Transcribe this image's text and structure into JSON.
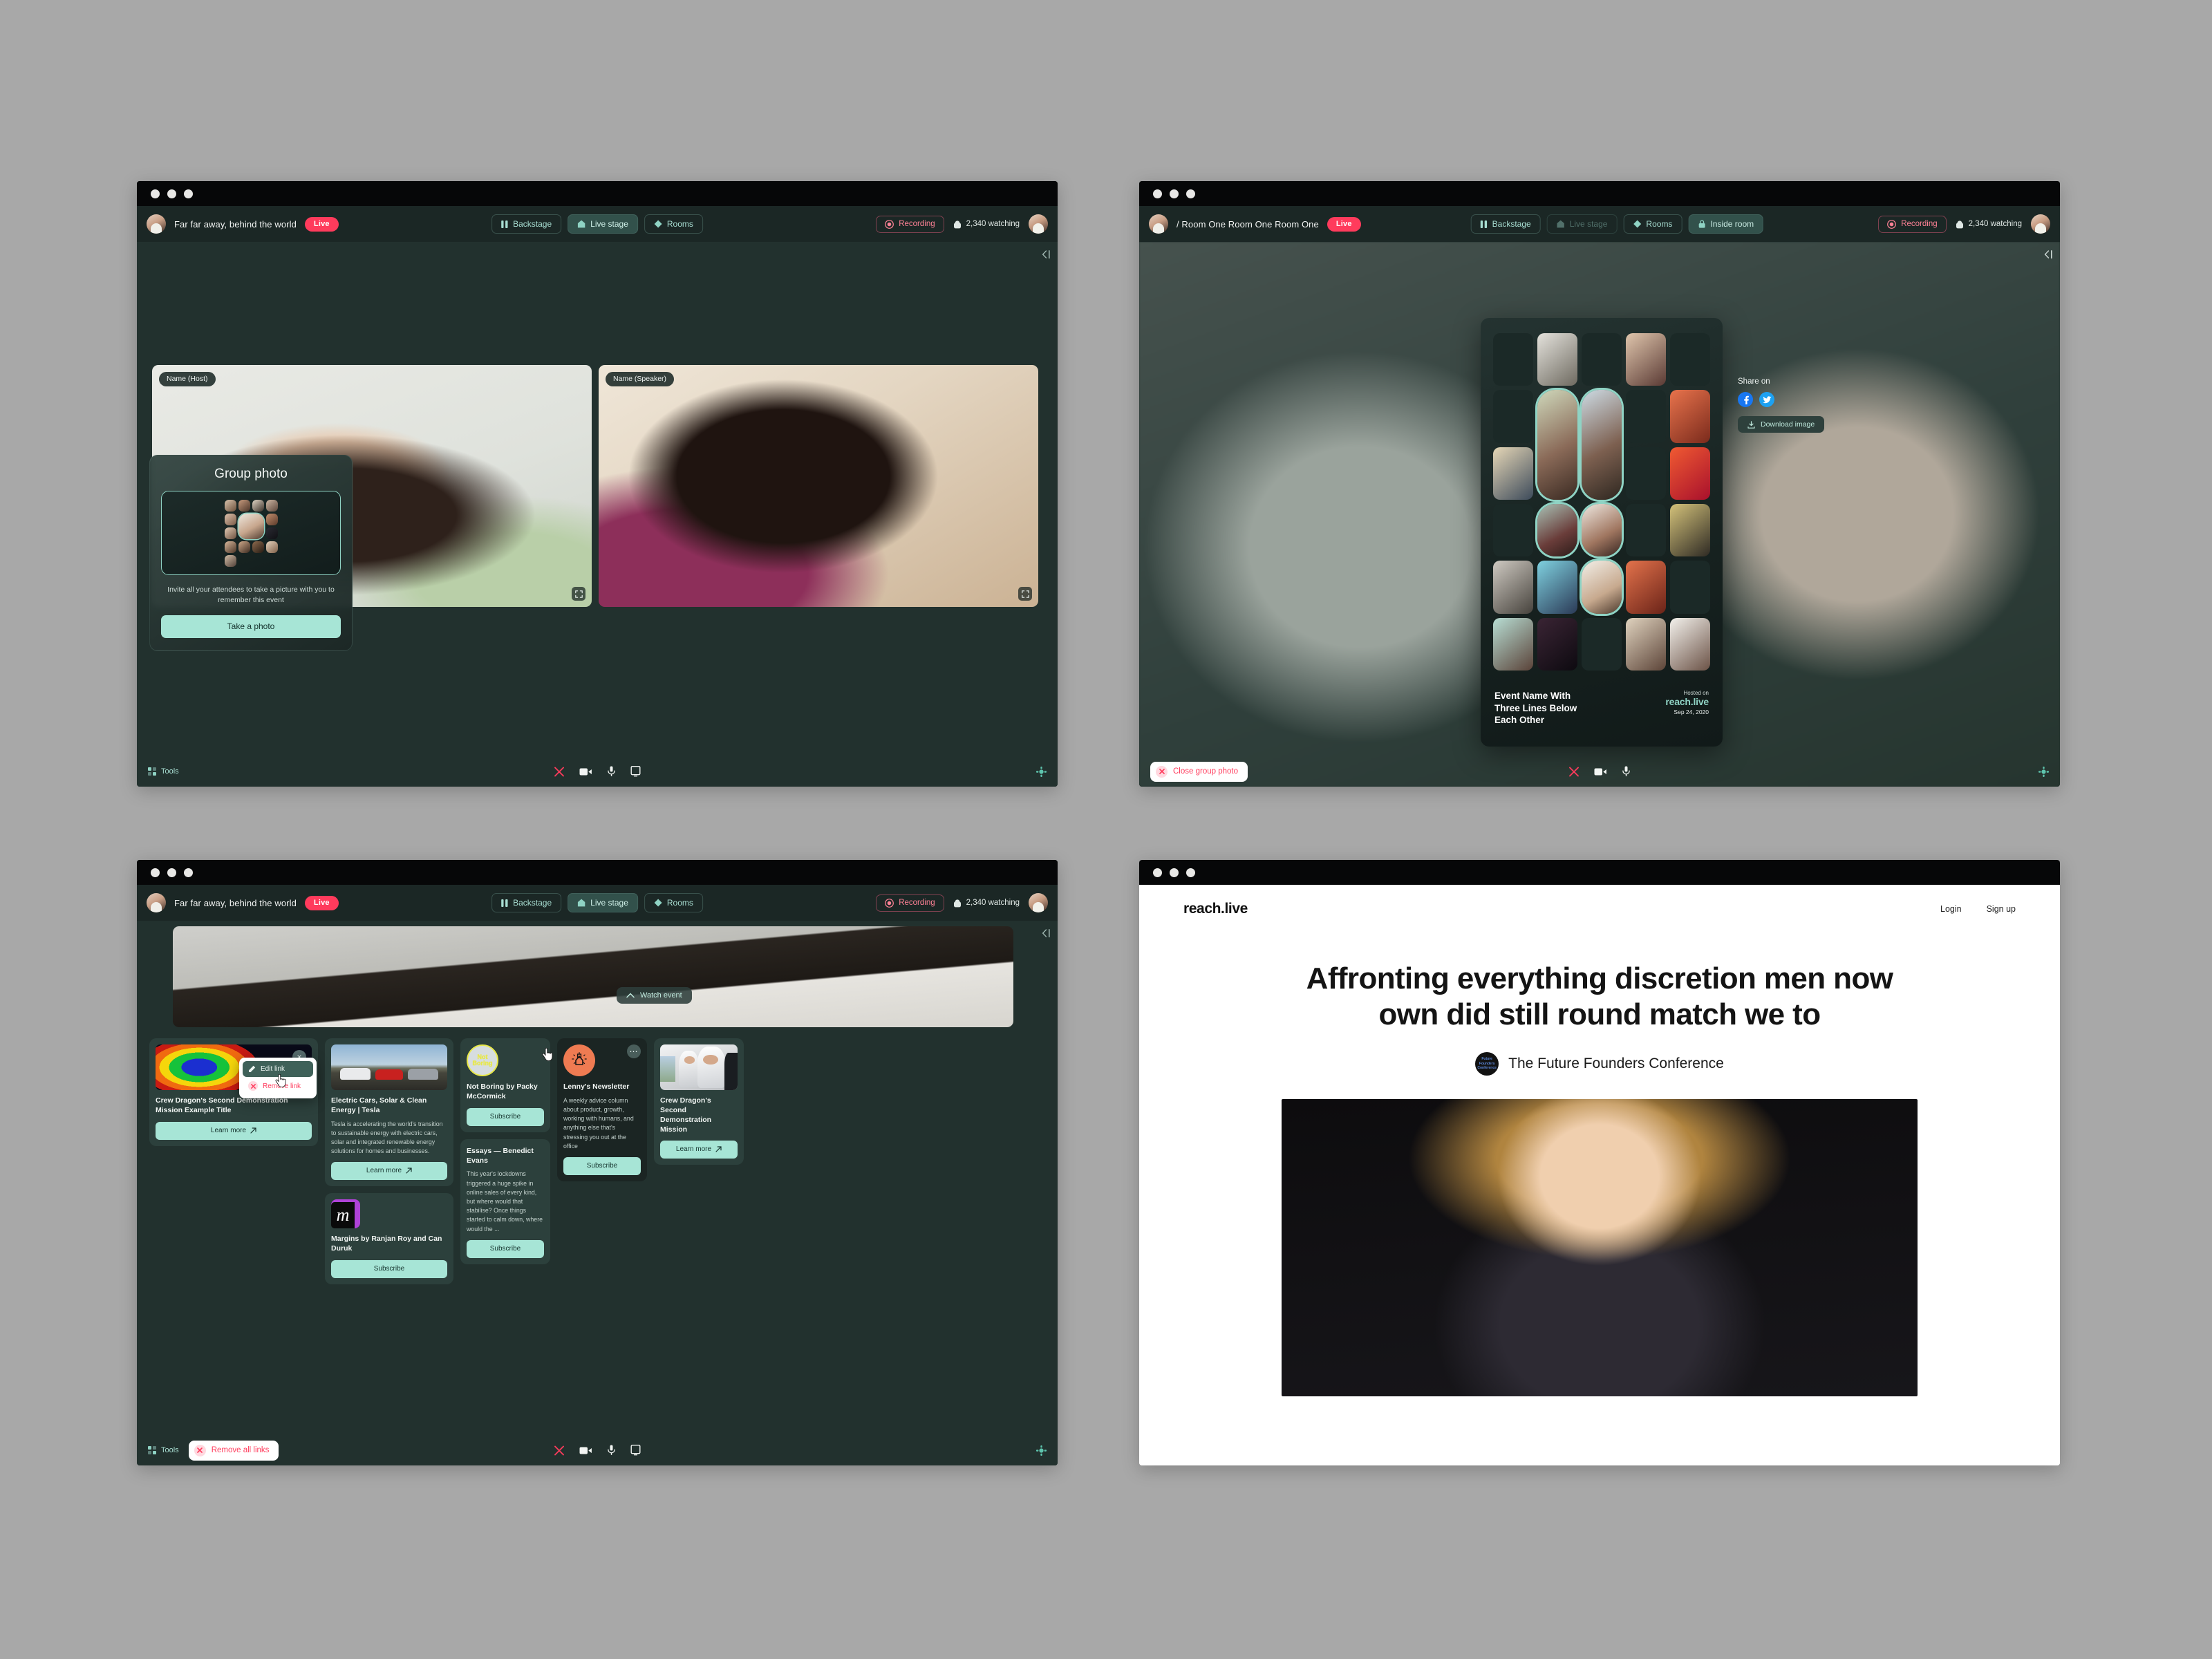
{
  "app": {
    "event_title": "Far far away, behind the world",
    "live_label": "Live",
    "nav": {
      "backstage": "Backstage",
      "live_stage": "Live stage",
      "rooms": "Rooms",
      "inside_room": "Inside room"
    },
    "recording_label": "Recording",
    "watching_label": "2,340 watching",
    "tools_label": "Tools"
  },
  "panel1": {
    "tiles": [
      {
        "name": "Name (Host)"
      },
      {
        "name": "Name (Speaker)"
      }
    ],
    "group_photo": {
      "title": "Group photo",
      "description": "Invite all your attendees to take a picture with you to remember this event",
      "cta": "Take a photo"
    }
  },
  "panel2": {
    "breadcrumb": "/ Room One Room One Room One",
    "close_group_photo": "Close group photo",
    "share": {
      "label": "Share on",
      "facebook": "f",
      "twitter": "t",
      "download": "Download image"
    },
    "card": {
      "event_name_line1": "Event Name With",
      "event_name_line2": "Three Lines Below",
      "event_name_line3": "Each Other",
      "hosted_on": "Hosted on",
      "brand": "reach.live",
      "date": "Sep 24, 2020"
    }
  },
  "panel3": {
    "watch_event": "Watch event",
    "remove_all_links": "Remove all links",
    "context_menu": {
      "edit": "Edit link",
      "remove": "Remove link"
    },
    "cards": [
      {
        "title": "Crew Dragon's Second Demonstration Mission Example Title",
        "cta": "Learn more",
        "kind": "link"
      },
      {
        "title": "Electric Cars, Solar & Clean Energy | Tesla",
        "description": "Tesla is accelerating the world's transition to sustainable energy with electric cars, solar and integrated renewable energy solutions for homes and businesses.",
        "cta": "Learn more",
        "kind": "link"
      },
      {
        "title": "Not Boring by Packy McCormick",
        "cta": "Subscribe",
        "kind": "newsletter"
      },
      {
        "title": "Essays — Benedict Evans",
        "description": "This year's lockdowns triggered a huge spike in online sales of every kind, but where would that stabilise? Once things started to calm down, where would the ...",
        "cta": "Subscribe",
        "kind": "newsletter"
      },
      {
        "title": "Margins by Ranjan Roy and Can Duruk",
        "cta": "Subscribe",
        "kind": "newsletter"
      },
      {
        "title": "Lenny's Newsletter",
        "description": "A weekly advice column about product, growth, working with humans, and anything else that's stressing you out at the office",
        "cta": "Subscribe",
        "kind": "newsletter"
      },
      {
        "title": "Crew Dragon's Second Demonstration Mission",
        "cta": "Learn more",
        "kind": "link"
      }
    ],
    "not_boring_logo_text": "Not Boring",
    "margins_logo_text": "m"
  },
  "panel4": {
    "logo": "reach.live",
    "login": "Login",
    "signup": "Sign up",
    "headline_line1": "Affronting everything discretion men now",
    "headline_line2": "own did still round match we to",
    "conference": "The Future Founders Conference",
    "badge_text": "Future Founders Conference"
  },
  "colors": {
    "accent_mint": "#a7e5d6",
    "live_red": "#ff3b5c",
    "panel_bg": "#22312e",
    "header_bg": "#1b2725"
  }
}
